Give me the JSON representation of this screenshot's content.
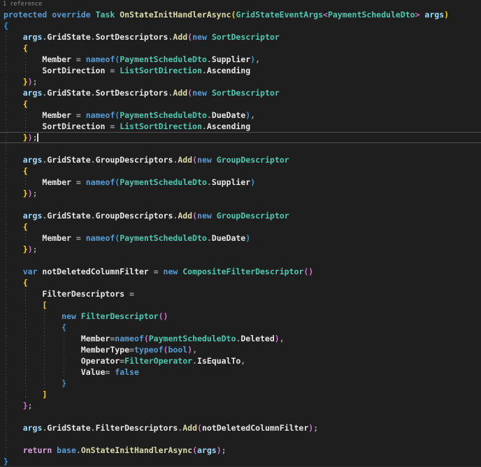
{
  "editor": {
    "codelens": "1 reference",
    "caret": {
      "line": 12,
      "col": 7
    },
    "colors": {
      "bg": "#1e1e1e",
      "kw": "#569cd6",
      "ctrl": "#d8a0df",
      "type": "#4ec9b0",
      "method": "#dcdcaa",
      "param": "#9cdcfe",
      "ident": "#e8e8e8",
      "punc": "#a0a0a0",
      "gold": "#ffd700",
      "pink": "#da70d6",
      "bblue": "#3a96d6",
      "lens": "#8c8c8c",
      "guide": "#3f3f3f",
      "clb": "#515151",
      "caret": "#e0e0e0"
    },
    "guides": [
      {
        "col": 0,
        "from": 3,
        "to": 40
      },
      {
        "col": 4,
        "from": 5,
        "to": 6
      },
      {
        "col": 4,
        "from": 10,
        "to": 11
      },
      {
        "col": 4,
        "from": 16,
        "to": 16
      },
      {
        "col": 4,
        "from": 21,
        "to": 21
      },
      {
        "col": 4,
        "from": 26,
        "to": 35
      },
      {
        "col": 8,
        "from": 28,
        "to": 34
      },
      {
        "col": 12,
        "from": 30,
        "to": 33
      }
    ],
    "lines": [
      [
        [
          "kw",
          "protected override "
        ],
        [
          "type",
          "Task "
        ],
        [
          "method",
          "OnStateInitHandlerAsync"
        ],
        [
          "gold",
          "("
        ],
        [
          "type",
          "GridStateEventArgs"
        ],
        [
          "pink",
          "<"
        ],
        [
          "type",
          "PaymentScheduleDto"
        ],
        [
          "pink",
          ">"
        ],
        [
          "param",
          " args"
        ],
        [
          "gold",
          ")"
        ]
      ],
      [
        [
          "bblue",
          "{"
        ]
      ],
      [
        [
          "pln",
          "    "
        ],
        [
          "param",
          "args"
        ],
        [
          "punc",
          "."
        ],
        [
          "ident",
          "GridState"
        ],
        [
          "punc",
          "."
        ],
        [
          "ident",
          "SortDescriptors"
        ],
        [
          "punc",
          "."
        ],
        [
          "method",
          "Add"
        ],
        [
          "pink",
          "("
        ],
        [
          "kw",
          "new "
        ],
        [
          "type",
          "SortDescriptor"
        ]
      ],
      [
        [
          "pln",
          "    "
        ],
        [
          "gold",
          "{"
        ]
      ],
      [
        [
          "pln",
          "        "
        ],
        [
          "ident",
          "Member"
        ],
        [
          "punc",
          " = "
        ],
        [
          "kw",
          "nameof"
        ],
        [
          "bblue",
          "("
        ],
        [
          "type",
          "PaymentScheduleDto"
        ],
        [
          "punc",
          "."
        ],
        [
          "ident",
          "Supplier"
        ],
        [
          "bblue",
          ")"
        ],
        [
          "punc",
          ","
        ]
      ],
      [
        [
          "pln",
          "        "
        ],
        [
          "ident",
          "SortDirection"
        ],
        [
          "punc",
          " = "
        ],
        [
          "type",
          "ListSortDirection"
        ],
        [
          "punc",
          "."
        ],
        [
          "ident",
          "Ascending"
        ]
      ],
      [
        [
          "pln",
          "    "
        ],
        [
          "gold",
          "}"
        ],
        [
          "pink",
          ")"
        ],
        [
          "punc",
          ";"
        ]
      ],
      [
        [
          "pln",
          "    "
        ],
        [
          "param",
          "args"
        ],
        [
          "punc",
          "."
        ],
        [
          "ident",
          "GridState"
        ],
        [
          "punc",
          "."
        ],
        [
          "ident",
          "SortDescriptors"
        ],
        [
          "punc",
          "."
        ],
        [
          "method",
          "Add"
        ],
        [
          "pink",
          "("
        ],
        [
          "kw",
          "new "
        ],
        [
          "type",
          "SortDescriptor"
        ]
      ],
      [
        [
          "pln",
          "    "
        ],
        [
          "gold",
          "{"
        ]
      ],
      [
        [
          "pln",
          "        "
        ],
        [
          "ident",
          "Member"
        ],
        [
          "punc",
          " = "
        ],
        [
          "kw",
          "nameof"
        ],
        [
          "bblue",
          "("
        ],
        [
          "type",
          "PaymentScheduleDto"
        ],
        [
          "punc",
          "."
        ],
        [
          "ident",
          "DueDate"
        ],
        [
          "bblue",
          ")"
        ],
        [
          "punc",
          ","
        ]
      ],
      [
        [
          "pln",
          "        "
        ],
        [
          "ident",
          "SortDirection"
        ],
        [
          "punc",
          " = "
        ],
        [
          "type",
          "ListSortDirection"
        ],
        [
          "punc",
          "."
        ],
        [
          "ident",
          "Ascending"
        ]
      ],
      [
        [
          "pln",
          "    "
        ],
        [
          "gold",
          "}"
        ],
        [
          "pink",
          ")"
        ],
        [
          "punc",
          ";"
        ]
      ],
      [],
      [
        [
          "pln",
          "    "
        ],
        [
          "param",
          "args"
        ],
        [
          "punc",
          "."
        ],
        [
          "ident",
          "GridState"
        ],
        [
          "punc",
          "."
        ],
        [
          "ident",
          "GroupDescriptors"
        ],
        [
          "punc",
          "."
        ],
        [
          "method",
          "Add"
        ],
        [
          "pink",
          "("
        ],
        [
          "kw",
          "new "
        ],
        [
          "type",
          "GroupDescriptor"
        ]
      ],
      [
        [
          "pln",
          "    "
        ],
        [
          "gold",
          "{"
        ]
      ],
      [
        [
          "pln",
          "        "
        ],
        [
          "ident",
          "Member"
        ],
        [
          "punc",
          " = "
        ],
        [
          "kw",
          "nameof"
        ],
        [
          "bblue",
          "("
        ],
        [
          "type",
          "PaymentScheduleDto"
        ],
        [
          "punc",
          "."
        ],
        [
          "ident",
          "Supplier"
        ],
        [
          "bblue",
          ")"
        ]
      ],
      [
        [
          "pln",
          "    "
        ],
        [
          "gold",
          "}"
        ],
        [
          "pink",
          ")"
        ],
        [
          "punc",
          ";"
        ]
      ],
      [],
      [
        [
          "pln",
          "    "
        ],
        [
          "param",
          "args"
        ],
        [
          "punc",
          "."
        ],
        [
          "ident",
          "GridState"
        ],
        [
          "punc",
          "."
        ],
        [
          "ident",
          "GroupDescriptors"
        ],
        [
          "punc",
          "."
        ],
        [
          "method",
          "Add"
        ],
        [
          "pink",
          "("
        ],
        [
          "kw",
          "new "
        ],
        [
          "type",
          "GroupDescriptor"
        ]
      ],
      [
        [
          "pln",
          "    "
        ],
        [
          "gold",
          "{"
        ]
      ],
      [
        [
          "pln",
          "        "
        ],
        [
          "ident",
          "Member"
        ],
        [
          "punc",
          " = "
        ],
        [
          "kw",
          "nameof"
        ],
        [
          "bblue",
          "("
        ],
        [
          "type",
          "PaymentScheduleDto"
        ],
        [
          "punc",
          "."
        ],
        [
          "ident",
          "DueDate"
        ],
        [
          "bblue",
          ")"
        ]
      ],
      [
        [
          "pln",
          "    "
        ],
        [
          "gold",
          "}"
        ],
        [
          "pink",
          ")"
        ],
        [
          "punc",
          ";"
        ]
      ],
      [],
      [
        [
          "pln",
          "    "
        ],
        [
          "kw",
          "var "
        ],
        [
          "ident",
          "notDeletedColumnFilter"
        ],
        [
          "punc",
          " = "
        ],
        [
          "kw",
          "new "
        ],
        [
          "type",
          "CompositeFilterDescriptor"
        ],
        [
          "pink",
          "()"
        ]
      ],
      [
        [
          "pln",
          "    "
        ],
        [
          "gold",
          "{"
        ]
      ],
      [
        [
          "pln",
          "        "
        ],
        [
          "ident",
          "FilterDescriptors"
        ],
        [
          "punc",
          " ="
        ]
      ],
      [
        [
          "pln",
          "        "
        ],
        [
          "gold",
          "["
        ]
      ],
      [
        [
          "pln",
          "            "
        ],
        [
          "kw",
          "new "
        ],
        [
          "type",
          "FilterDescriptor"
        ],
        [
          "pink",
          "()"
        ]
      ],
      [
        [
          "pln",
          "            "
        ],
        [
          "bblue",
          "{"
        ]
      ],
      [
        [
          "pln",
          "                "
        ],
        [
          "ident",
          "Member"
        ],
        [
          "punc",
          "="
        ],
        [
          "kw",
          "nameof"
        ],
        [
          "pink",
          "("
        ],
        [
          "type",
          "PaymentScheduleDto"
        ],
        [
          "punc",
          "."
        ],
        [
          "ident",
          "Deleted"
        ],
        [
          "pink",
          ")"
        ],
        [
          "punc",
          ","
        ]
      ],
      [
        [
          "pln",
          "                "
        ],
        [
          "ident",
          "MemberType"
        ],
        [
          "punc",
          "="
        ],
        [
          "kw",
          "typeof"
        ],
        [
          "pink",
          "("
        ],
        [
          "kw",
          "bool"
        ],
        [
          "pink",
          ")"
        ],
        [
          "punc",
          ","
        ]
      ],
      [
        [
          "pln",
          "                "
        ],
        [
          "ident",
          "Operator"
        ],
        [
          "punc",
          "="
        ],
        [
          "type",
          "FilterOperator"
        ],
        [
          "punc",
          "."
        ],
        [
          "ident",
          "IsEqualTo"
        ],
        [
          "punc",
          ","
        ]
      ],
      [
        [
          "pln",
          "                "
        ],
        [
          "ident",
          "Value"
        ],
        [
          "punc",
          "= "
        ],
        [
          "kw",
          "false"
        ]
      ],
      [
        [
          "pln",
          "            "
        ],
        [
          "bblue",
          "}"
        ]
      ],
      [
        [
          "pln",
          "        "
        ],
        [
          "gold",
          "]"
        ]
      ],
      [
        [
          "pln",
          "    "
        ],
        [
          "pink",
          "}"
        ],
        [
          "punc",
          ";"
        ]
      ],
      [],
      [
        [
          "pln",
          "    "
        ],
        [
          "param",
          "args"
        ],
        [
          "punc",
          "."
        ],
        [
          "ident",
          "GridState"
        ],
        [
          "punc",
          "."
        ],
        [
          "ident",
          "FilterDescriptors"
        ],
        [
          "punc",
          "."
        ],
        [
          "method",
          "Add"
        ],
        [
          "pink",
          "("
        ],
        [
          "ident",
          "notDeletedColumnFilter"
        ],
        [
          "pink",
          ")"
        ],
        [
          "punc",
          ";"
        ]
      ],
      [],
      [
        [
          "pln",
          "    "
        ],
        [
          "ctrl",
          "return "
        ],
        [
          "kw",
          "base"
        ],
        [
          "punc",
          "."
        ],
        [
          "method",
          "OnStateInitHandlerAsync"
        ],
        [
          "pink",
          "("
        ],
        [
          "param",
          "args"
        ],
        [
          "pink",
          ")"
        ],
        [
          "punc",
          ";"
        ]
      ],
      [
        [
          "bblue",
          "}"
        ]
      ]
    ]
  }
}
